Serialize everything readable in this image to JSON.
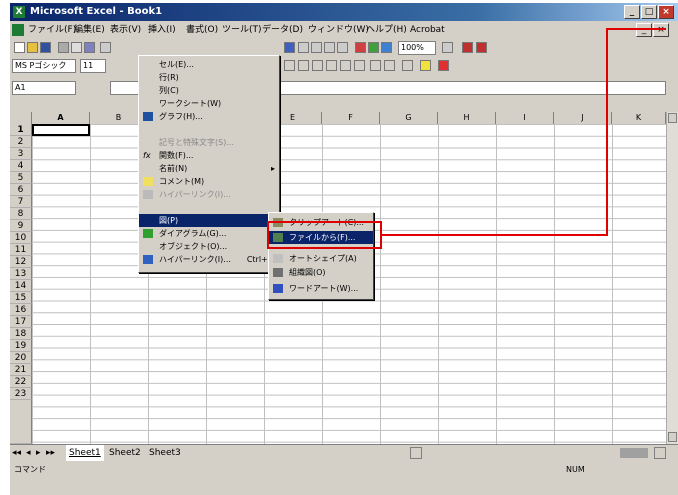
{
  "window": {
    "title": "Microsoft Excel - Book1"
  },
  "titlebar_buttons": [
    "_",
    "□",
    "×"
  ],
  "doc_buttons": [
    "_",
    "×"
  ],
  "menubar": [
    "ファイル(F)",
    "編集(E)",
    "表示(V)",
    "挿入(I)",
    "書式(O)",
    "ツール(T)",
    "データ(D)",
    "ウィンドウ(W)",
    "ヘルプ(H)",
    "Acrobat"
  ],
  "formatting": {
    "font_name": "MS Pゴシック",
    "font_size": "11",
    "zoom": "100%"
  },
  "namebox": "A1",
  "columns": [
    "A",
    "B",
    "C",
    "D",
    "E",
    "F",
    "G",
    "H",
    "I",
    "J",
    "K"
  ],
  "rows": [
    "1",
    "2",
    "3",
    "4",
    "5",
    "6",
    "7",
    "8",
    "9",
    "10",
    "11",
    "12",
    "13",
    "14",
    "15",
    "16",
    "17",
    "18",
    "19",
    "20",
    "21",
    "22",
    "23"
  ],
  "insert_menu": [
    {
      "label": "セル(E)...",
      "disabled": false
    },
    {
      "label": "行(R)",
      "disabled": false
    },
    {
      "label": "列(C)",
      "disabled": false
    },
    {
      "label": "ワークシート(W)",
      "disabled": false
    },
    {
      "label": "グラフ(H)...",
      "disabled": false
    },
    {
      "label": "記号と特殊文字(S)...",
      "disabled": true
    },
    {
      "label": "関数(F)...",
      "disabled": false
    },
    {
      "label": "名前(N)",
      "disabled": false,
      "submenu": true
    },
    {
      "label": "コメント(M)",
      "disabled": false
    },
    {
      "label": "ハイパーリンク(I)...",
      "disabled": true
    },
    {
      "label": "図(P)",
      "disabled": false,
      "submenu": true,
      "selected": true
    },
    {
      "label": "ダイアグラム(G)...",
      "disabled": false
    },
    {
      "label": "オブジェクト(O)...",
      "disabled": false
    },
    {
      "label": "ハイパーリンク(I)...",
      "disabled": false,
      "shortcut": "Ctrl+K"
    }
  ],
  "picture_submenu": [
    {
      "label": "クリップアート(C)...",
      "selected": false
    },
    {
      "label": "ファイルから(F)...",
      "selected": true
    },
    {
      "label": "オートシェイプ(A)",
      "selected": false
    },
    {
      "label": "組織図(O)",
      "selected": false
    },
    {
      "label": "ワードアート(W)...",
      "selected": false
    }
  ],
  "sheet_tabs": [
    "Sheet1",
    "Sheet2",
    "Sheet3"
  ],
  "status": {
    "left": "コマンド",
    "right": "NUM"
  }
}
